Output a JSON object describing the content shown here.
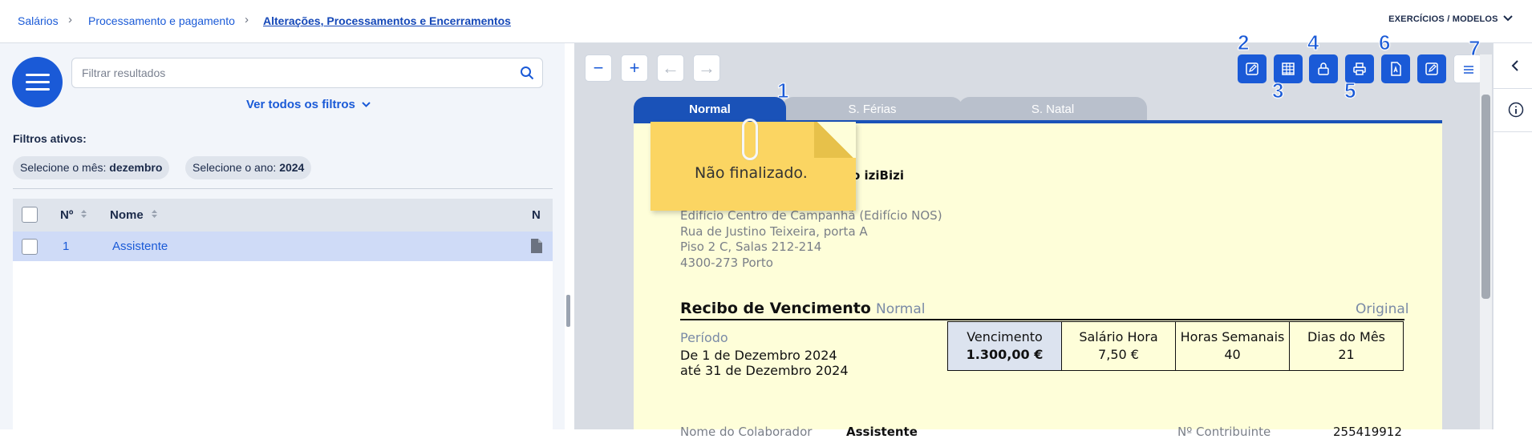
{
  "breadcrumb": {
    "items": [
      "Salários",
      "Processamento e pagamento",
      "Alterações, Processamentos e Encerramentos"
    ]
  },
  "header": {
    "exercicios_label": "EXERCÍCIOS / MODELOS"
  },
  "filters": {
    "search_placeholder": "Filtrar resultados",
    "see_all": "Ver todos os filtros",
    "active_label": "Filtros ativos:",
    "chips": [
      {
        "prefix": "Selecione o mês: ",
        "value": "dezembro"
      },
      {
        "prefix": "Selecione o ano: ",
        "value": "2024"
      }
    ]
  },
  "table": {
    "columns": [
      "Nº",
      "Nome",
      "N"
    ],
    "rows": [
      {
        "num": "1",
        "name": "Assistente"
      }
    ]
  },
  "toolbar": {
    "zoom_out": "−",
    "zoom_in": "+",
    "prev": "←",
    "next": "→",
    "numbers": [
      "1",
      "2",
      "3",
      "4",
      "5",
      "6",
      "7"
    ]
  },
  "tabs": [
    "Normal",
    "S. Férias",
    "S. Natal"
  ],
  "note": {
    "text": "Não finalizado."
  },
  "document": {
    "company": "o iziBizi",
    "address": [
      "Edifício Centro de Campanhã (Edifício NOS)",
      "Rua de Justino Teixeira, porta A",
      "Piso 2 C, Salas 212-214",
      "4300-273 Porto"
    ],
    "receipt_title": "Recibo de Vencimento",
    "receipt_type": "Normal",
    "receipt_copy": "Original",
    "period_label": "Período",
    "period_from": "De 1 de Dezembro 2024",
    "period_to": "até 31 de Dezembro 2024",
    "summary": [
      {
        "label": "Vencimento",
        "value": "1.300,00 €"
      },
      {
        "label": "Salário Hora",
        "value": "7,50 €"
      },
      {
        "label": "Horas Semanais",
        "value": "40"
      },
      {
        "label": "Dias do Mês",
        "value": "21"
      }
    ],
    "bottom_left": "Nome do Colaborador",
    "bottom_left_value": "Assistente",
    "bottom_right": "Nº Contribuinte",
    "bottom_right_value": "255419912"
  }
}
